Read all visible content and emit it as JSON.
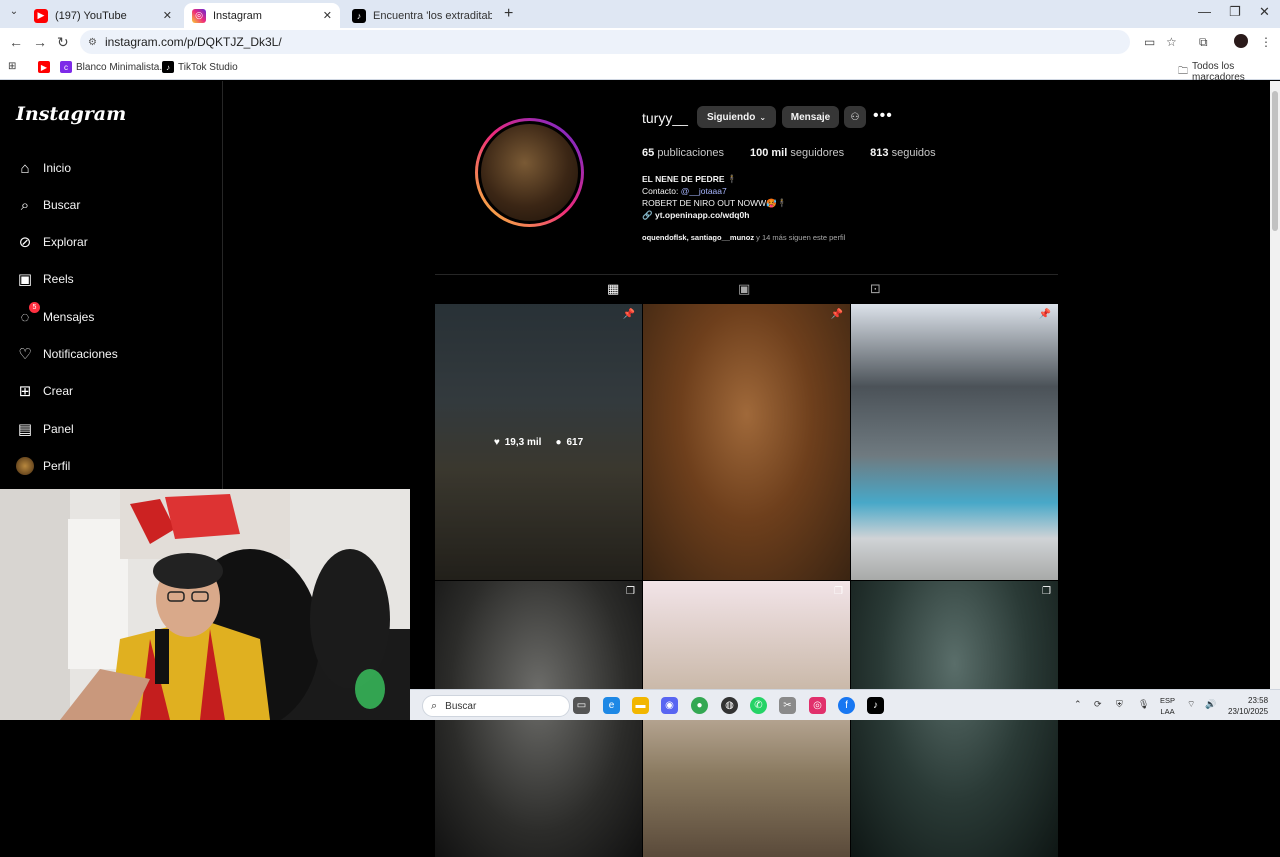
{
  "browser": {
    "tabs": [
      {
        "title": "(197) YouTube",
        "icon": "youtube-icon",
        "color": "#ff0000"
      },
      {
        "title": "Instagram",
        "icon": "instagram-icon",
        "color": "#e1306c"
      },
      {
        "title": "Encuentra 'los extraditablesd c",
        "icon": "tiktok-icon",
        "color": "#000000"
      }
    ],
    "url": "instagram.com/p/DQKTJZ_Dk3L/",
    "bookmarks": [
      {
        "label": "",
        "icon": "youtube-icon"
      },
      {
        "label": "Blanco Minimalista...",
        "icon": "canva-icon"
      },
      {
        "label": "TikTok Studio",
        "icon": "tiktok-icon"
      }
    ],
    "all_bookmarks": "Todos los marcadores"
  },
  "instagram": {
    "logo": "Instagram",
    "nav": [
      {
        "label": "Inicio",
        "icon": "home-icon"
      },
      {
        "label": "Buscar",
        "icon": "search-icon"
      },
      {
        "label": "Explorar",
        "icon": "compass-icon"
      },
      {
        "label": "Reels",
        "icon": "reels-icon"
      },
      {
        "label": "Mensajes",
        "icon": "messenger-icon",
        "badge": "5"
      },
      {
        "label": "Notificaciones",
        "icon": "heart-icon"
      },
      {
        "label": "Crear",
        "icon": "plus-square-icon"
      },
      {
        "label": "Panel",
        "icon": "panel-icon"
      },
      {
        "label": "Perfil",
        "icon": "avatar"
      }
    ],
    "profile": {
      "username": "turyy__",
      "following_btn": "Siguiendo",
      "message_btn": "Mensaje",
      "posts_count": "65",
      "posts_label": "publicaciones",
      "followers_count": "100 mil",
      "followers_label": "seguidores",
      "following_count": "813",
      "following_label": "seguidos",
      "bio_name": "EL NENE DE PEDRE 🕴",
      "bio_contact_label": "Contacto:",
      "bio_contact_handle": "@__jotaaa7",
      "bio_line": "ROBERT DE NIRO OUT NOWW🥵🕴",
      "bio_link": "yt.openinapp.co/wdq0h",
      "followed_names": "oquendoflsk, santiago__munoz",
      "followed_rest": " y 14 más siguen este perfil"
    },
    "hover_post": {
      "likes": "19,3 mil",
      "comments": "617"
    }
  },
  "taskbar": {
    "search_placeholder": "Buscar",
    "lang_top": "ESP",
    "lang_bottom": "LAA",
    "time": "23:58",
    "date": "23/10/2025"
  }
}
